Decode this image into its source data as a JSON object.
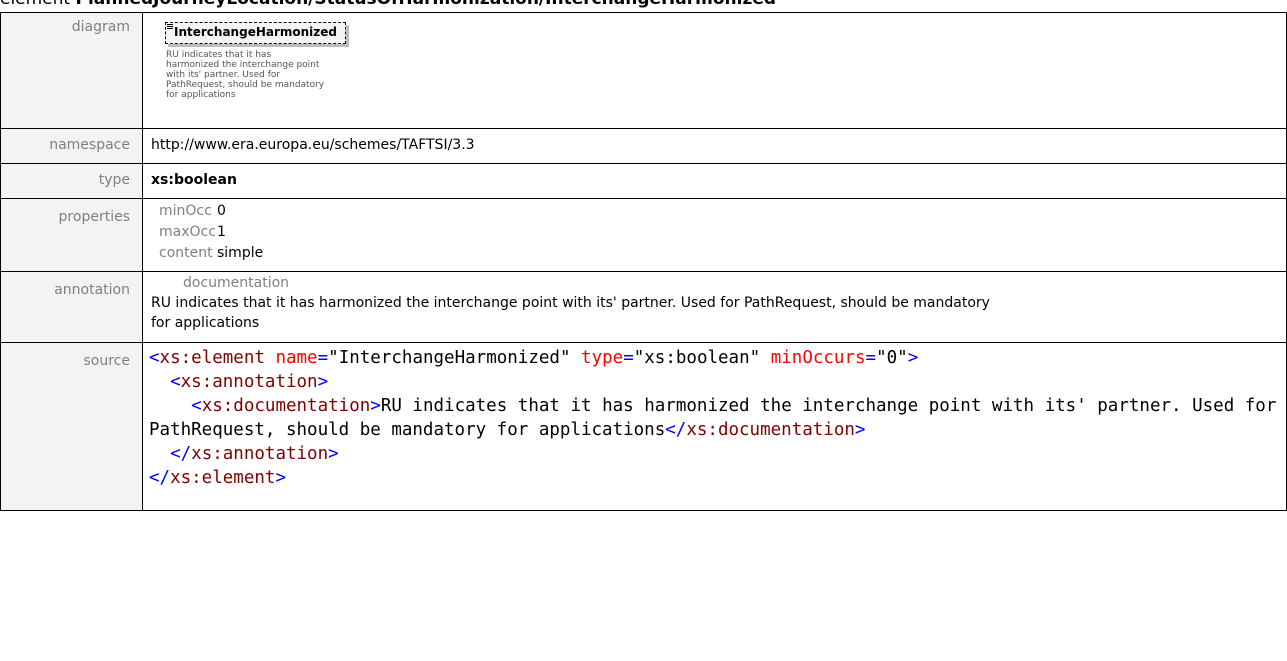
{
  "heading": {
    "prefix": "element ",
    "path": "PlannedJourneyLocation/StatusOfHarmonization/InterchangeHarmonized"
  },
  "labels": {
    "diagram": "diagram",
    "namespace": "namespace",
    "type": "type",
    "properties": "properties",
    "annotation": "annotation",
    "source": "source"
  },
  "diagram": {
    "element_name": "InterchangeHarmonized",
    "documentation": "RU indicates that it has harmonized the interchange point with its' partner. Used for PathRequest, should be mandatory for applications"
  },
  "namespace": "http://www.era.europa.eu/schemes/TAFTSI/3.3",
  "type": "xs:boolean",
  "properties": [
    {
      "key": "minOcc",
      "value": "0"
    },
    {
      "key": "maxOcc",
      "value": "1"
    },
    {
      "key": "content",
      "value": "simple"
    }
  ],
  "annotation": {
    "label": "documentation",
    "text": "RU indicates that it has harmonized the interchange point with its' partner. Used for PathRequest, should be mandatory for applications"
  },
  "source": {
    "line1": {
      "open": "<",
      "tag": "xs:element",
      "a1": "name",
      "eq1": "=",
      "v1": "\"InterchangeHarmonized\"",
      "a2": "type",
      "eq2": "=",
      "v2": "\"xs:boolean\"",
      "a3": "minOccurs",
      "eq3": "=",
      "v3": "\"0\"",
      "close": ">"
    },
    "line2": {
      "open": "<",
      "tag": "xs:annotation",
      "close": ">"
    },
    "line3": {
      "open": "<",
      "tag": "xs:documentation",
      "close": ">",
      "text": "RU indicates that it has harmonized the interchange point with its' partner. Used for PathRequest, should be mandatory for applications",
      "end_open": "</",
      "end_tag": "xs:documentation",
      "end_close": ">"
    },
    "line4": {
      "open": "</",
      "tag": "xs:annotation",
      "close": ">"
    },
    "line5": {
      "open": "</",
      "tag": "xs:element",
      "close": ">"
    }
  }
}
